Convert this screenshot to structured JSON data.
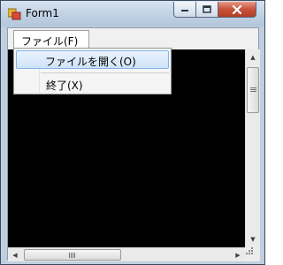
{
  "window": {
    "title": "Form1",
    "minimize_glyph": "—",
    "maximize_glyph": "□",
    "close_glyph": "✕"
  },
  "menubar": {
    "file_menu_label": "ファイル(F)"
  },
  "dropdown": {
    "items": [
      {
        "label": "ファイルを開く(O)",
        "highlighted": true
      },
      {
        "label": "終了(X)",
        "highlighted": false
      }
    ]
  },
  "scrollbars": {
    "vertical_up_glyph": "▲",
    "vertical_down_glyph": "▼",
    "horizontal_left_glyph": "◀",
    "horizontal_right_glyph": "▶"
  },
  "colors": {
    "content_background": "#000000",
    "menu_highlight": "#cfe3f9",
    "close_button": "#c9523b"
  }
}
